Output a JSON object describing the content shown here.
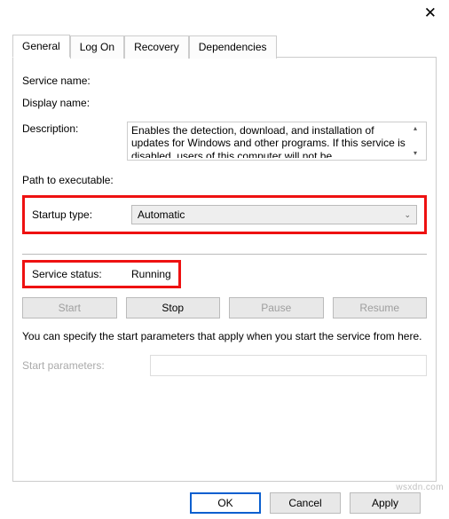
{
  "tabs": {
    "general": "General",
    "logon": "Log On",
    "recovery": "Recovery",
    "dependencies": "Dependencies"
  },
  "fields": {
    "service_name_label": "Service name:",
    "service_name_value": "",
    "display_name_label": "Display name:",
    "display_name_value": "",
    "description_label": "Description:",
    "description_value": "Enables the detection, download, and installation of updates for Windows and other programs. If this service is disabled, users of this computer will not be",
    "path_label": "Path to executable:",
    "path_value": "",
    "startup_type_label": "Startup type:",
    "startup_type_value": "Automatic",
    "service_status_label": "Service status:",
    "service_status_value": "Running",
    "note": "You can specify the start parameters that apply when you start the service from here.",
    "start_parameters_label": "Start parameters:",
    "start_parameters_value": ""
  },
  "svcButtons": {
    "start": "Start",
    "stop": "Stop",
    "pause": "Pause",
    "resume": "Resume"
  },
  "dialogButtons": {
    "ok": "OK",
    "cancel": "Cancel",
    "apply": "Apply"
  },
  "watermark": "wsxdn.com"
}
